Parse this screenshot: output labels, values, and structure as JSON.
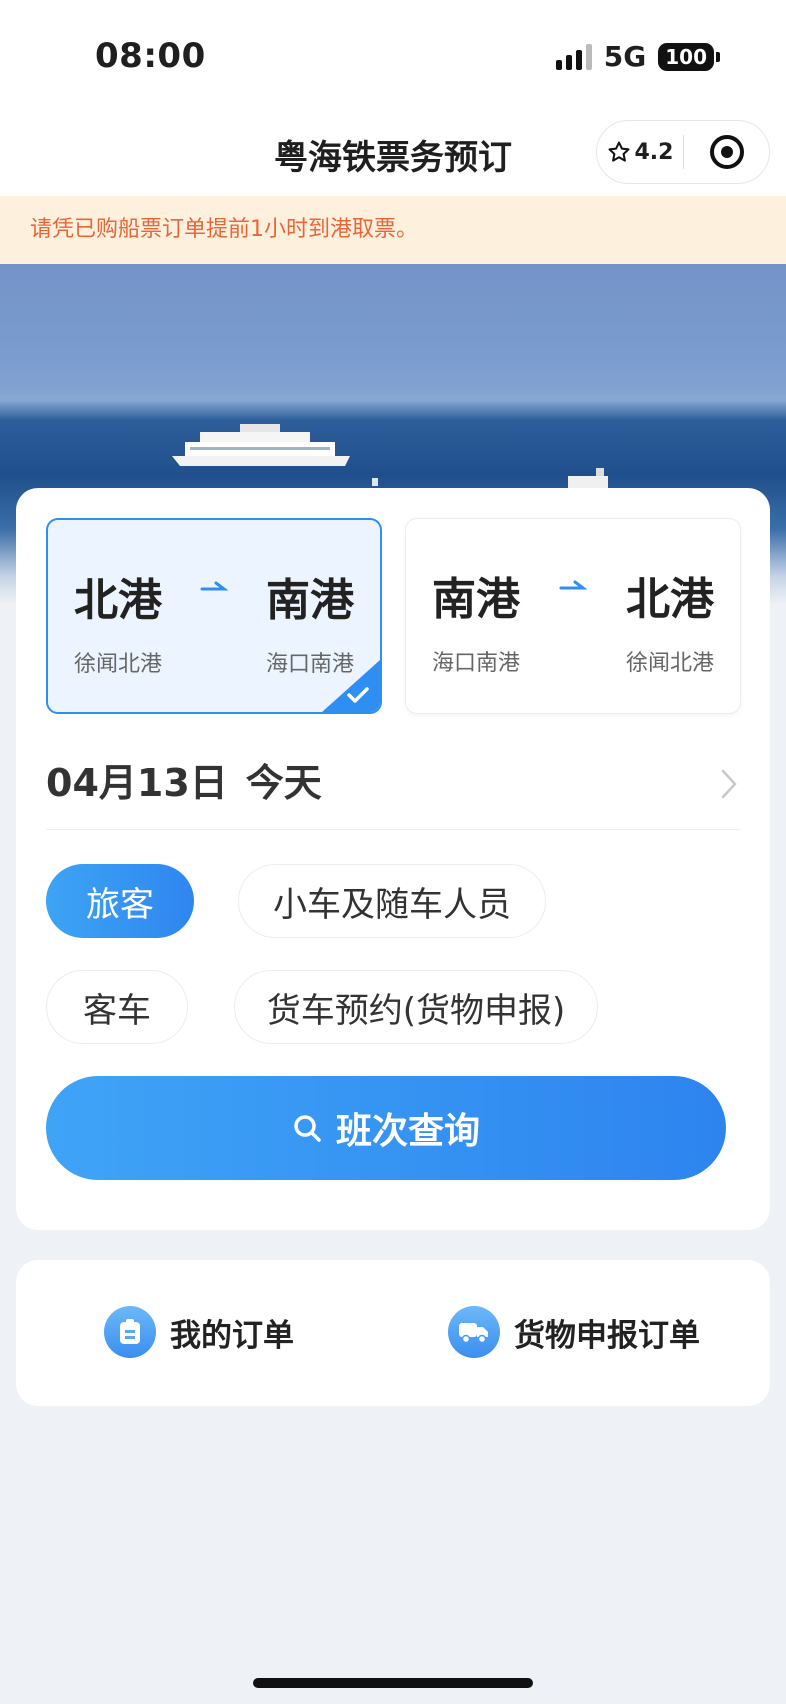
{
  "status": {
    "time": "08:00",
    "network": "5G",
    "battery": "100"
  },
  "nav": {
    "title": "粤海铁票务预订",
    "rating": "4.2"
  },
  "notice": "请凭已购船票订单提前1小时到港取票。",
  "routes": [
    {
      "from": "北港",
      "to": "南港",
      "from_sub": "徐闻北港",
      "to_sub": "海口南港",
      "selected": true
    },
    {
      "from": "南港",
      "to": "北港",
      "from_sub": "海口南港",
      "to_sub": "徐闻北港",
      "selected": false
    }
  ],
  "date": {
    "value": "04月13日",
    "label": "今天"
  },
  "categories": [
    {
      "label": "旅客",
      "active": true
    },
    {
      "label": "小车及随车人员",
      "active": false
    },
    {
      "label": "客车",
      "active": false
    },
    {
      "label": "货车预约(货物申报)",
      "active": false
    }
  ],
  "search_button": "班次查询",
  "orders": {
    "my_orders": "我的订单",
    "cargo_orders": "货物申报订单"
  },
  "colors": {
    "accent": "#2f8ef2",
    "notice_text": "#e8673a",
    "notice_bg": "#fdf0dd"
  }
}
